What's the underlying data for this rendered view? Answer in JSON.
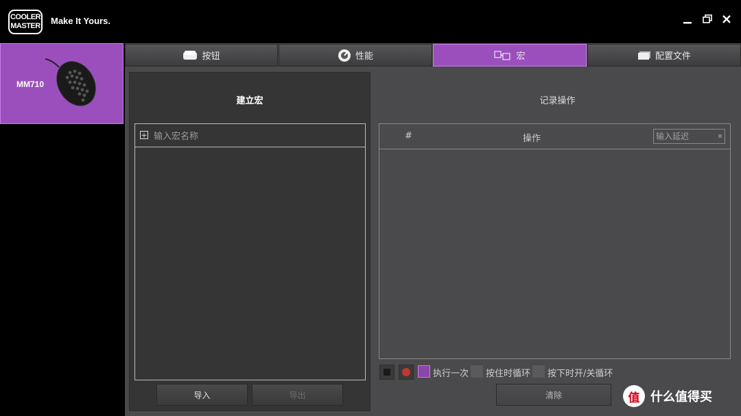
{
  "app": {
    "logo_text": "COOLER MASTER",
    "tagline": "Make It Yours."
  },
  "window_controls": {
    "minimize": "minimize-icon",
    "restore": "restore-icon",
    "close": "close-icon"
  },
  "device": {
    "name": "MM710",
    "image": "mouse-icon"
  },
  "tabs": [
    {
      "label": "按钮",
      "icon": "button-icon",
      "active": false
    },
    {
      "label": "性能",
      "icon": "performance-icon",
      "active": false
    },
    {
      "label": "宏",
      "icon": "macro-icon",
      "active": true
    },
    {
      "label": "配置文件",
      "icon": "profile-icon",
      "active": false
    }
  ],
  "macro_panel": {
    "title": "建立宏",
    "name_placeholder": "输入宏名称",
    "import_label": "导入",
    "export_label": "导出"
  },
  "record_panel": {
    "title": "记录操作",
    "col_number": "#",
    "col_action": "操作",
    "delay_placeholder": "输入延迟",
    "options": [
      {
        "label": "执行一次",
        "checked": true
      },
      {
        "label": "按住时循环",
        "checked": false
      },
      {
        "label": "按下时开/关循环",
        "checked": false
      }
    ],
    "clear_label": "清除"
  },
  "watermark": {
    "icon_text": "值",
    "text": "什么值得买"
  },
  "colors": {
    "accent": "#9b4fbd",
    "panel": "#4a4a4c",
    "dark_panel": "#353536"
  }
}
